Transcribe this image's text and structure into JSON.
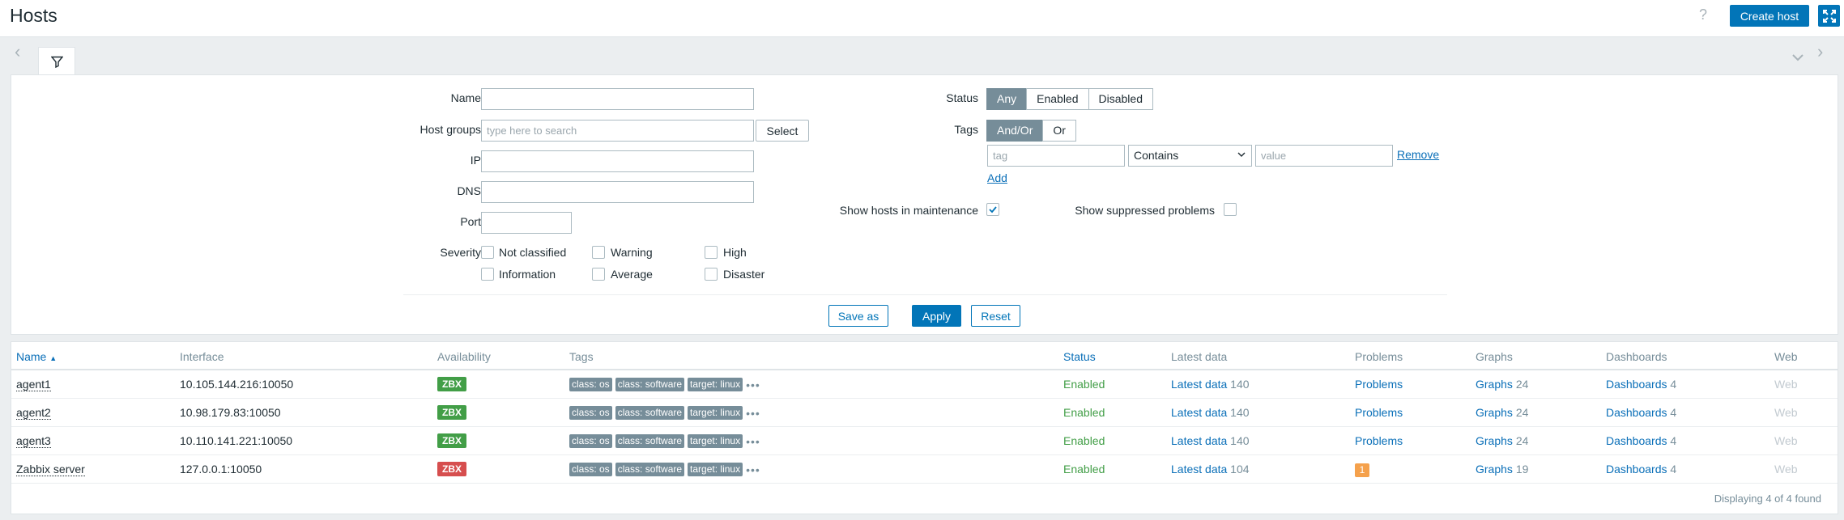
{
  "page": {
    "title": "Hosts",
    "create_label": "Create host",
    "help_icon": "?"
  },
  "filter": {
    "name_label": "Name",
    "name_value": "",
    "host_groups_label": "Host groups",
    "host_groups_placeholder": "type here to search",
    "select_label": "Select",
    "ip_label": "IP",
    "dns_label": "DNS",
    "port_label": "Port",
    "severity_label": "Severity",
    "severities": [
      "Not classified",
      "Warning",
      "High",
      "Information",
      "Average",
      "Disaster"
    ],
    "status_label": "Status",
    "status_options": [
      "Any",
      "Enabled",
      "Disabled"
    ],
    "status_selected": "Any",
    "tags_label": "Tags",
    "tags_options": [
      "And/Or",
      "Or"
    ],
    "tags_selected": "And/Or",
    "tag_placeholder": "tag",
    "operator_value": "Contains",
    "value_placeholder": "value",
    "remove_label": "Remove",
    "add_label": "Add",
    "maintenance_label": "Show hosts in maintenance",
    "maintenance_checked": true,
    "suppressed_label": "Show suppressed problems",
    "suppressed_checked": false,
    "save_as_label": "Save as",
    "apply_label": "Apply",
    "reset_label": "Reset"
  },
  "table": {
    "headers": {
      "name": "Name",
      "interface": "Interface",
      "availability": "Availability",
      "tags": "Tags",
      "status": "Status",
      "latest_data": "Latest data",
      "problems": "Problems",
      "graphs": "Graphs",
      "dashboards": "Dashboards",
      "web": "Web"
    },
    "rows": [
      {
        "name": "agent1",
        "interface": "10.105.144.216:10050",
        "availability": "ZBX",
        "avail_color": "#429e47",
        "tags": [
          "class: os",
          "class: software",
          "target: linux"
        ],
        "status": "Enabled",
        "latest_label": "Latest data",
        "latest_count": "140",
        "problems": "Problems",
        "problems_badge": "",
        "graphs_label": "Graphs",
        "graphs_count": "24",
        "dashboards_label": "Dashboards",
        "dashboards_count": "4",
        "web": "Web"
      },
      {
        "name": "agent2",
        "interface": "10.98.179.83:10050",
        "availability": "ZBX",
        "avail_color": "#429e47",
        "tags": [
          "class: os",
          "class: software",
          "target: linux"
        ],
        "status": "Enabled",
        "latest_label": "Latest data",
        "latest_count": "140",
        "problems": "Problems",
        "problems_badge": "",
        "graphs_label": "Graphs",
        "graphs_count": "24",
        "dashboards_label": "Dashboards",
        "dashboards_count": "4",
        "web": "Web"
      },
      {
        "name": "agent3",
        "interface": "10.110.141.221:10050",
        "availability": "ZBX",
        "avail_color": "#429e47",
        "tags": [
          "class: os",
          "class: software",
          "target: linux"
        ],
        "status": "Enabled",
        "latest_label": "Latest data",
        "latest_count": "140",
        "problems": "Problems",
        "problems_badge": "",
        "graphs_label": "Graphs",
        "graphs_count": "24",
        "dashboards_label": "Dashboards",
        "dashboards_count": "4",
        "web": "Web"
      },
      {
        "name": "Zabbix server",
        "interface": "127.0.0.1:10050",
        "availability": "ZBX",
        "avail_color": "#d64e4e",
        "tags": [
          "class: os",
          "class: software",
          "target: linux"
        ],
        "status": "Enabled",
        "latest_label": "Latest data",
        "latest_count": "104",
        "problems": "",
        "problems_badge": "1",
        "graphs_label": "Graphs",
        "graphs_count": "19",
        "dashboards_label": "Dashboards",
        "dashboards_count": "4",
        "web": "Web"
      }
    ],
    "footer": "Displaying 4 of 4 found"
  }
}
